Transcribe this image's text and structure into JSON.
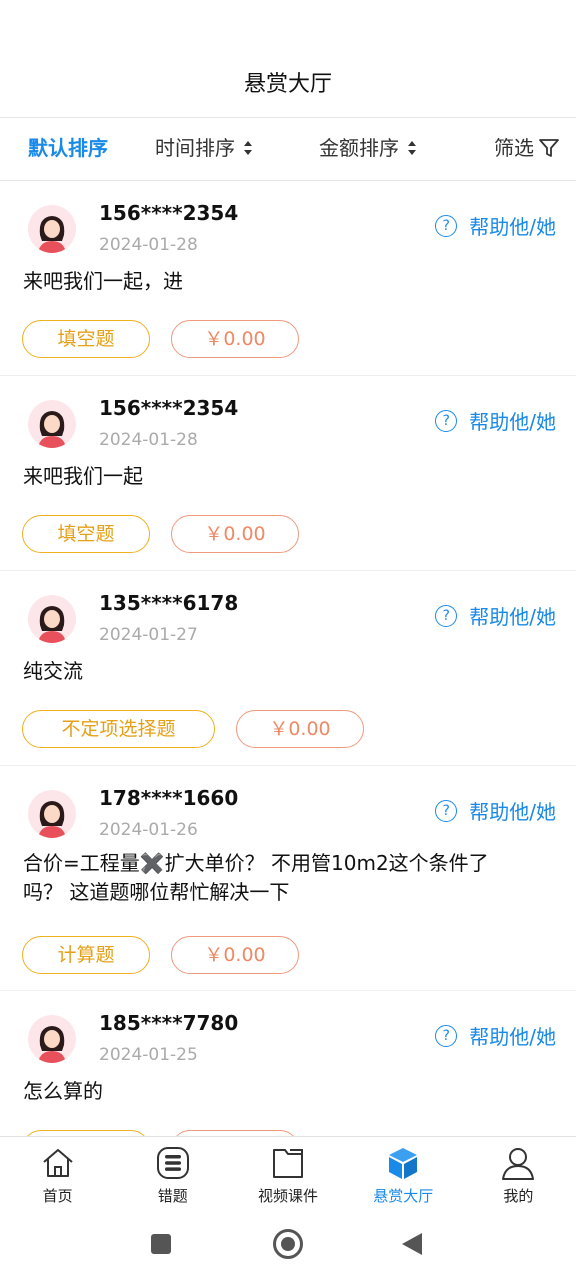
{
  "header": {
    "title": "悬赏大厅"
  },
  "sort": {
    "default": "默认排序",
    "time": "时间排序",
    "amount": "金额排序",
    "filter": "筛选"
  },
  "help_label": "帮助他/她",
  "posts": [
    {
      "user": "156****2354",
      "date": "2024-01-28",
      "content": "来吧我们一起，进",
      "type": "填空题",
      "amount": "￥0.00"
    },
    {
      "user": "156****2354",
      "date": "2024-01-28",
      "content": "来吧我们一起",
      "type": "填空题",
      "amount": "￥0.00"
    },
    {
      "user": "135****6178",
      "date": "2024-01-27",
      "content": "纯交流",
      "type": "不定项选择题",
      "amount": "￥0.00"
    },
    {
      "user": "178****1660",
      "date": "2024-01-26",
      "content_line1": "合价=工程量✖️扩大单价？ 不用管10m2这个条件了",
      "content_line2": "吗？ 这道题哪位帮忙解决一下",
      "type": "计算题",
      "amount": "￥0.00"
    },
    {
      "user": "185****7780",
      "date": "2024-01-25",
      "content": "怎么算的",
      "type": "",
      "amount": ""
    }
  ],
  "tabs": [
    {
      "label": "首页",
      "icon": "home-icon"
    },
    {
      "label": "错题",
      "icon": "list-icon"
    },
    {
      "label": "视频课件",
      "icon": "folder-icon"
    },
    {
      "label": "悬赏大厅",
      "icon": "cube-icon",
      "active": true
    },
    {
      "label": "我的",
      "icon": "user-icon"
    }
  ],
  "colors": {
    "accent": "#1a8ae8",
    "tag_type": "#e6a017",
    "tag_amount": "#ef8a66"
  }
}
